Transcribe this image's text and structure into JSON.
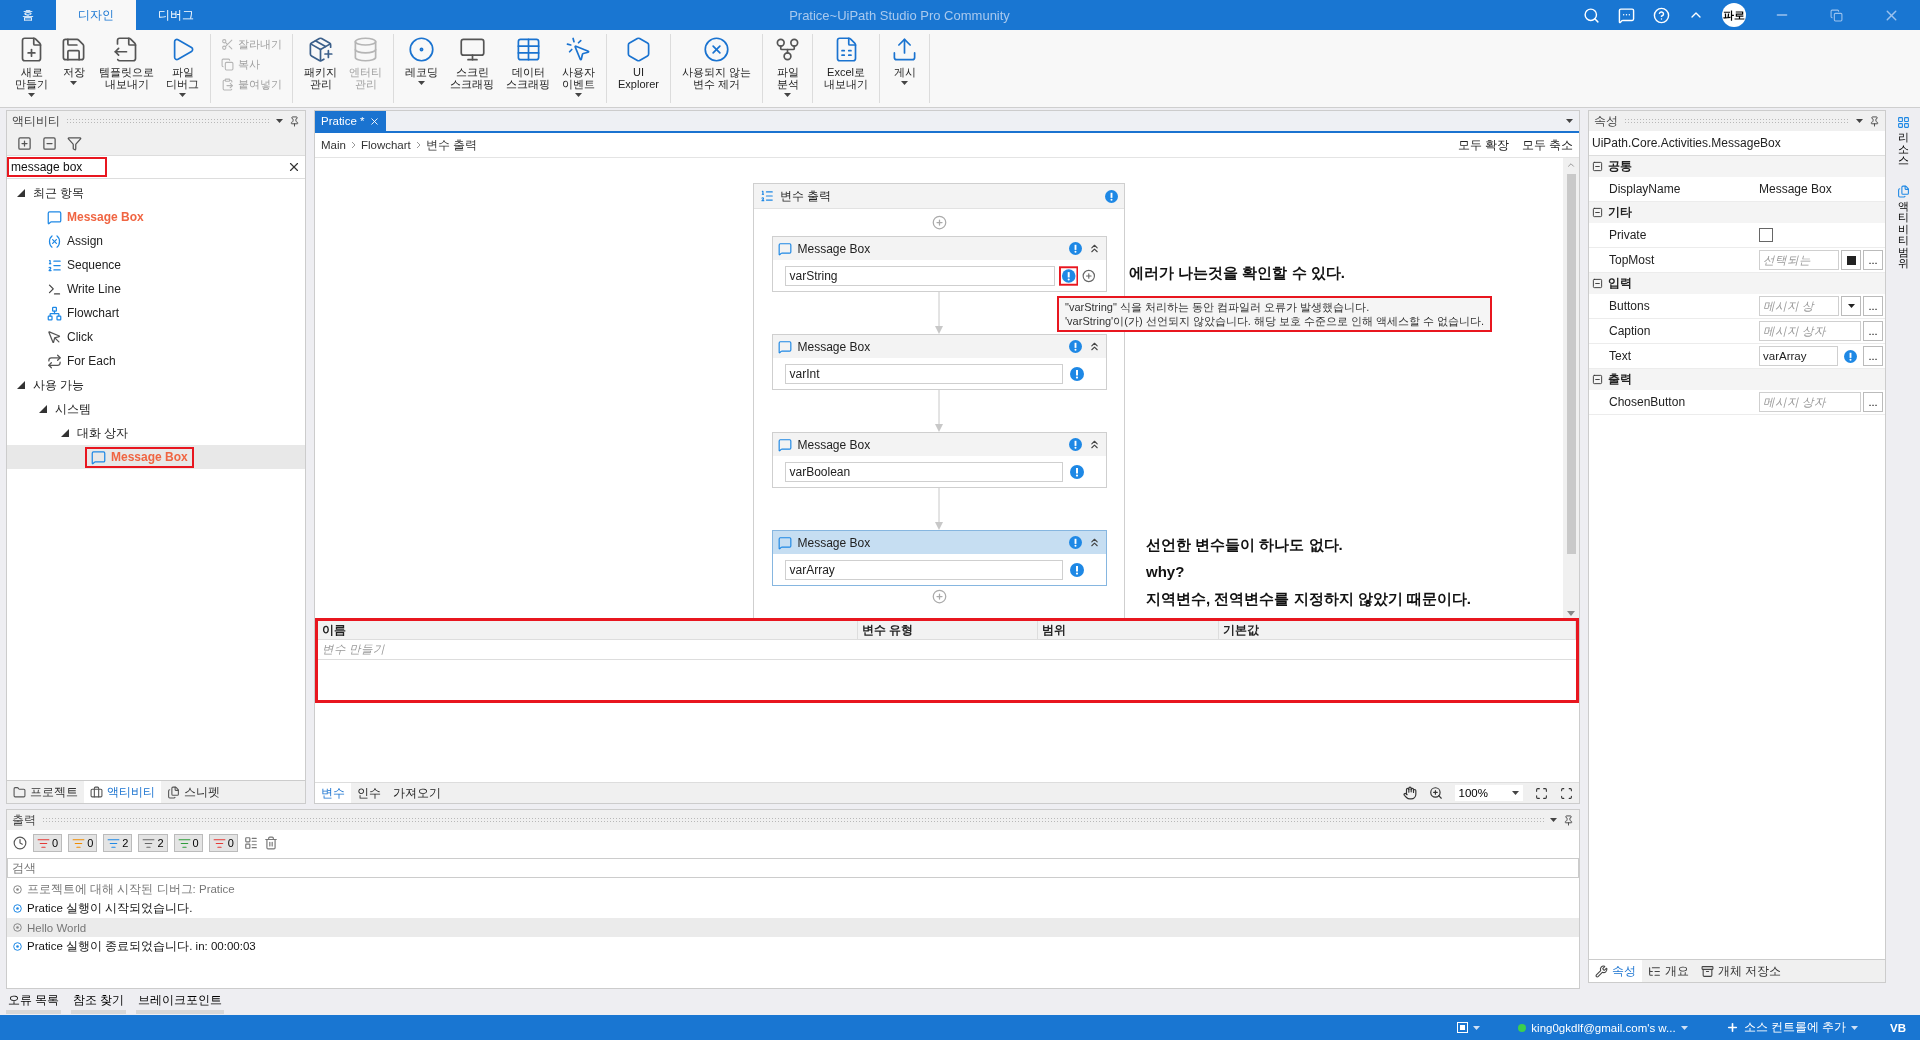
{
  "title_bar": {
    "tabs": [
      {
        "label": "홈",
        "selected": false
      },
      {
        "label": "디자인",
        "selected": true
      },
      {
        "label": "디버그",
        "selected": false
      }
    ],
    "title": "Pratice~UiPath Studio Pro Community",
    "user_badge": "파로"
  },
  "ribbon": {
    "groups": [
      {
        "items": [
          {
            "kind": "large",
            "label": "새로\n만들기",
            "dropdown": true,
            "disabled": false
          },
          {
            "kind": "large",
            "label": "저장",
            "dropdown": true,
            "disabled": false
          },
          {
            "kind": "large",
            "label": "템플릿으로\n내보내기",
            "dropdown": false,
            "disabled": false
          },
          {
            "kind": "large",
            "label": "파일\n디버그",
            "dropdown": true,
            "disabled": false
          }
        ]
      },
      {
        "items": [
          {
            "kind": "small",
            "label": "잘라내기",
            "disabled": true
          },
          {
            "kind": "small",
            "label": "복사",
            "disabled": true
          },
          {
            "kind": "small",
            "label": "붙여넣기",
            "disabled": true
          }
        ]
      },
      {
        "items": [
          {
            "kind": "large",
            "label": "패키지\n관리",
            "dropdown": false,
            "disabled": false
          },
          {
            "kind": "large",
            "label": "엔터티\n관리",
            "dropdown": false,
            "disabled": true
          }
        ]
      },
      {
        "items": [
          {
            "kind": "large",
            "label": "레코딩",
            "dropdown": true,
            "disabled": false
          },
          {
            "kind": "large",
            "label": "스크린\n스크래핑",
            "dropdown": false,
            "disabled": false
          },
          {
            "kind": "large",
            "label": "데이터\n스크래핑",
            "dropdown": false,
            "disabled": false
          },
          {
            "kind": "large",
            "label": "사용자\n이벤트",
            "dropdown": true,
            "disabled": false
          }
        ]
      },
      {
        "items": [
          {
            "kind": "large",
            "label": "UI\nExplorer",
            "dropdown": false,
            "disabled": false
          }
        ]
      },
      {
        "items": [
          {
            "kind": "large",
            "label": "사용되지 않는\n변수 제거",
            "dropdown": false,
            "disabled": false
          }
        ]
      },
      {
        "items": [
          {
            "kind": "large",
            "label": "파일\n분석",
            "dropdown": true,
            "disabled": false
          }
        ]
      },
      {
        "items": [
          {
            "kind": "large",
            "label": "Excel로\n내보내기",
            "dropdown": false,
            "disabled": false
          }
        ]
      },
      {
        "items": [
          {
            "kind": "large",
            "label": "게시",
            "dropdown": true,
            "disabled": false
          }
        ]
      }
    ]
  },
  "activities_panel": {
    "title": "액티비티",
    "search": {
      "value": "message box",
      "highlighted": true
    },
    "tree": [
      {
        "label": "최근 항목",
        "expanded": true,
        "children": [
          {
            "label": "Message Box",
            "kind": "message",
            "match": true,
            "selected": false,
            "highlighted": false
          },
          {
            "label": "Assign",
            "kind": "assign",
            "match": false,
            "selected": false,
            "highlighted": false
          },
          {
            "label": "Sequence",
            "kind": "sequence",
            "match": false,
            "selected": false,
            "highlighted": false
          },
          {
            "label": "Write Line",
            "kind": "writeline",
            "match": false,
            "selected": false,
            "highlighted": false
          },
          {
            "label": "Flowchart",
            "kind": "flowchart",
            "match": false,
            "selected": false,
            "highlighted": false
          },
          {
            "label": "Click",
            "kind": "click",
            "match": false,
            "selected": false,
            "highlighted": false
          },
          {
            "label": "For Each",
            "kind": "foreach",
            "match": false,
            "selected": false,
            "highlighted": false
          }
        ]
      },
      {
        "label": "사용 가능",
        "expanded": true,
        "children": [
          {
            "label": "시스템",
            "expanded": true,
            "children": [
              {
                "label": "대화 상자",
                "expanded": true,
                "children": [
                  {
                    "label": "Message Box",
                    "kind": "message",
                    "match": true,
                    "selected": true,
                    "highlighted": true
                  }
                ]
              }
            ]
          }
        ]
      }
    ],
    "bottom_tabs": [
      {
        "label": "프로젝트",
        "selected": false
      },
      {
        "label": "액티비티",
        "selected": true
      },
      {
        "label": "스니펫",
        "selected": false
      }
    ]
  },
  "designer": {
    "tabs": [
      {
        "label": "Pratice *",
        "selected": true
      }
    ],
    "breadcrumb": [
      "Main",
      "Flowchart",
      "변수 출력"
    ],
    "actions": [
      "모두 확장",
      "모두 축소"
    ],
    "sequence": {
      "title": "변수 출력",
      "activities": [
        {
          "title": "Message Box",
          "value": "varString",
          "selected": false,
          "hovered": true,
          "highlighted": true
        },
        {
          "title": "Message Box",
          "value": "varInt",
          "selected": false,
          "hovered": false,
          "highlighted": false
        },
        {
          "title": "Message Box",
          "value": "varBoolean",
          "selected": false,
          "hovered": false,
          "highlighted": false
        },
        {
          "title": "Message Box",
          "value": "varArray",
          "selected": true,
          "hovered": false,
          "highlighted": false
        }
      ]
    },
    "tooltip": {
      "lines": [
        "\"varString\" 식을 처리하는 동안 컴파일러 오류가 발생했습니다.",
        "'varString'이(가) 선언되지 않았습니다. 해당 보호 수준으로 인해 액세스할 수 없습니다."
      ],
      "highlighted": true
    },
    "note_top": [
      "에러가 나는것을 확인할 수 있다."
    ],
    "note_bottom": [
      "선언한 변수들이 하나도 없다.",
      "why?",
      "지역변수, 전역변수를 지정하지 않았기 때문이다."
    ],
    "variables": {
      "columns": [
        "이름",
        "변수 유형",
        "범위",
        "기본값"
      ],
      "placeholder": "변수 만들기",
      "highlighted": true
    },
    "bottom_tabs": [
      {
        "label": "변수",
        "selected": true
      },
      {
        "label": "인수",
        "selected": false
      },
      {
        "label": "가져오기",
        "selected": false
      }
    ],
    "zoom": "100%"
  },
  "properties": {
    "title": "속성",
    "type_name": "UiPath.Core.Activities.MessageBox",
    "categories": [
      {
        "name": "공통",
        "rows": [
          {
            "name": "DisplayName",
            "kind": "text",
            "value": "Message Box"
          }
        ]
      },
      {
        "name": "기타",
        "rows": [
          {
            "name": "Private",
            "kind": "checkbox",
            "checked": false
          },
          {
            "name": "TopMost",
            "kind": "input",
            "placeholder": "선택되는",
            "square_button": true,
            "more": "..."
          }
        ]
      },
      {
        "name": "입력",
        "rows": [
          {
            "name": "Buttons",
            "kind": "input",
            "placeholder": "메시지 상",
            "dropdown": true,
            "more": "..."
          },
          {
            "name": "Caption",
            "kind": "input",
            "placeholder": "메시지 상자",
            "more": "..."
          },
          {
            "name": "Text",
            "kind": "input",
            "value": "varArray",
            "error": true,
            "more": "..."
          }
        ]
      },
      {
        "name": "출력",
        "rows": [
          {
            "name": "ChosenButton",
            "kind": "input",
            "placeholder": "메시지 상자",
            "more": "..."
          }
        ]
      }
    ],
    "bottom_tabs": [
      {
        "label": "속성",
        "selected": true
      },
      {
        "label": "개요",
        "selected": false
      },
      {
        "label": "개체 저장소",
        "selected": false
      }
    ]
  },
  "side_tabs": [
    {
      "label": "리소스"
    },
    {
      "label": "액티비티 범위"
    }
  ],
  "output": {
    "title": "출력",
    "filters": [
      {
        "kind": "error",
        "count": "0"
      },
      {
        "kind": "warning",
        "count": "0"
      },
      {
        "kind": "info",
        "count": "2"
      },
      {
        "kind": "trace",
        "count": "2"
      },
      {
        "kind": "success",
        "count": "0"
      },
      {
        "kind": "failure",
        "count": "0"
      }
    ],
    "search_placeholder": "검색",
    "log": [
      {
        "kind": "trace",
        "text": "프로젝트에 대해 시작된 디버그: Pratice",
        "selected": false
      },
      {
        "kind": "info",
        "text": "Pratice 실행이 시작되었습니다.",
        "selected": false
      },
      {
        "kind": "trace",
        "text": "Hello World",
        "selected": true
      },
      {
        "kind": "info",
        "text": "Pratice 실행이 종료되었습니다. in: 00:00:03",
        "selected": false
      }
    ]
  },
  "bottom_tabs": [
    "오류 목록",
    "참조 찾기",
    "브레이크포인트"
  ],
  "status_bar": {
    "account": "king0gkdlf@gmail.com's w...",
    "source_control": "소스 컨트롤에 추가",
    "language": "VB"
  }
}
